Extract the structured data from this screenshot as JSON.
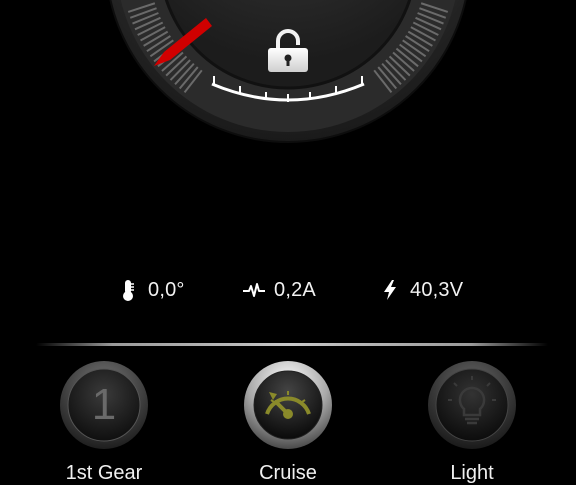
{
  "gauge": {
    "lock_icon": "unlock-icon",
    "needle_color": "#d00000"
  },
  "stats": [
    {
      "icon": "thermometer-icon",
      "value": "0,0°"
    },
    {
      "icon": "pulse-icon",
      "value": "0,2A"
    },
    {
      "icon": "bolt-icon",
      "value": "40,3V"
    }
  ],
  "controls": [
    {
      "label": "1st Gear",
      "icon": "gear-1-icon",
      "glyph": "1",
      "active": false
    },
    {
      "label": "Cruise",
      "icon": "speedometer-icon",
      "active": true
    },
    {
      "label": "Light",
      "icon": "lightbulb-icon",
      "active": false
    }
  ],
  "colors": {
    "cruise_accent": "#8a8a2a",
    "background": "#000000"
  }
}
